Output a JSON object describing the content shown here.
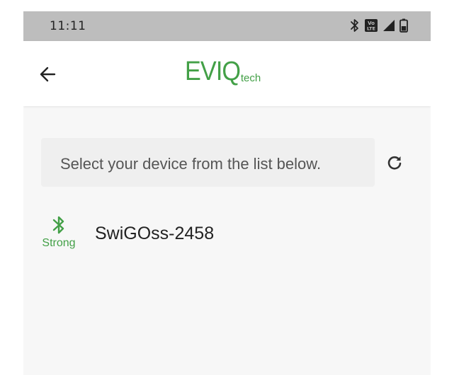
{
  "status_bar": {
    "time": "11:11",
    "icons": [
      "bluetooth-icon",
      "volte-icon",
      "signal-icon",
      "battery-icon"
    ],
    "volte_text": "Vo LTE"
  },
  "app_bar": {
    "back_icon": "arrow-left-icon",
    "logo_main": "EVIQ",
    "logo_sub": "tech",
    "brand_color": "#43a047"
  },
  "main": {
    "instruction": "Select your device from the list below.",
    "refresh_icon": "refresh-icon",
    "devices": [
      {
        "name": "SwiGOss-2458",
        "signal_label": "Strong",
        "signal_icon": "bluetooth-icon"
      }
    ]
  },
  "colors": {
    "status_bar_bg": "#bdbdbd",
    "page_bg": "#f7f7f7",
    "accent": "#43a047"
  }
}
